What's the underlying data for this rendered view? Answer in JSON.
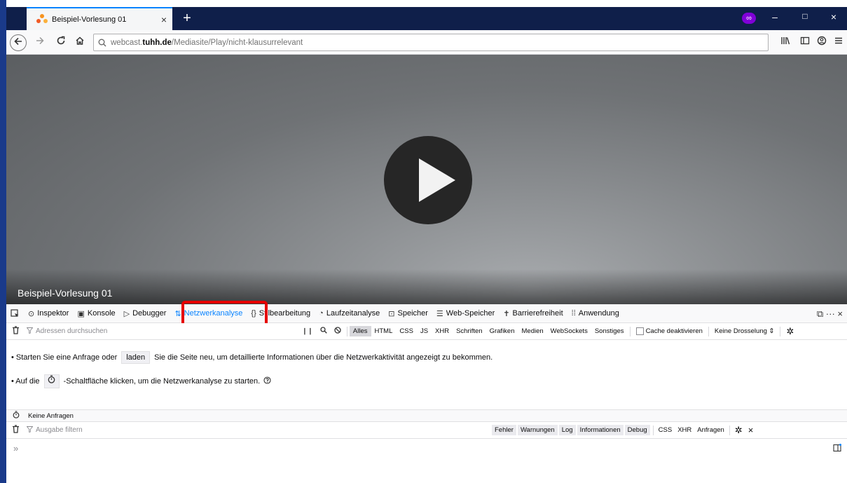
{
  "browser": {
    "tab_title": "Beispiel-Vorlesung 01",
    "tab_close": "×",
    "new_tab": "+",
    "private_badge": "∞",
    "window_controls": [
      "–",
      "□",
      "×"
    ]
  },
  "navbar": {
    "url_prefix": "webcast.",
    "url_domain": "tuhh.de",
    "url_path": "/Mediasite/Play/nicht-klausurrelevant"
  },
  "video": {
    "title": "Beispiel-Vorlesung 01"
  },
  "devtools": {
    "tabs": [
      {
        "icon": "⊙",
        "label": "Inspektor"
      },
      {
        "icon": "▣",
        "label": "Konsole"
      },
      {
        "icon": "▷",
        "label": "Debugger"
      },
      {
        "icon": "⇅",
        "label": "Netzwerkanalyse"
      },
      {
        "icon": "{}",
        "label": "Stilbearbeitung"
      },
      {
        "icon": "◔",
        "label": "Laufzeitanalyse"
      },
      {
        "icon": "⊡",
        "label": "Speicher"
      },
      {
        "icon": "☰",
        "label": "Web-Speicher"
      },
      {
        "icon": "✝",
        "label": "Barrierefreiheit"
      },
      {
        "icon": "⁞⁞",
        "label": "Anwendung"
      }
    ],
    "active_tab": "Netzwerkanalyse",
    "right_controls": "⧉  ···  ×",
    "filter_placeholder": "Adressen durchsuchen",
    "filter_types": [
      "Alles",
      "HTML",
      "CSS",
      "JS",
      "XHR",
      "Schriften",
      "Grafiken",
      "Medien",
      "WebSockets",
      "Sonstiges"
    ],
    "cache_label": "Cache deaktivieren",
    "throttle_label": "Keine Drosselung ⇕",
    "msg1_prefix": "• Starten Sie eine Anfrage oder",
    "msg1_button": "laden",
    "msg1_suffix": "Sie die Seite neu, um detaillierte Informationen über die Netzwerkaktivität angezeigt zu bekommen.",
    "msg2_prefix": "• Auf die",
    "msg2_suffix": "-Schaltfläche klicken, um die Netzwerkanalyse zu starten.",
    "status_text": "Keine Anfragen",
    "console_placeholder": "Ausgabe filtern",
    "console_levels": [
      "Fehler",
      "Warnungen",
      "Log",
      "Informationen",
      "Debug"
    ],
    "console_extra": [
      "CSS",
      "XHR",
      "Anfragen"
    ],
    "prompt": "»"
  }
}
